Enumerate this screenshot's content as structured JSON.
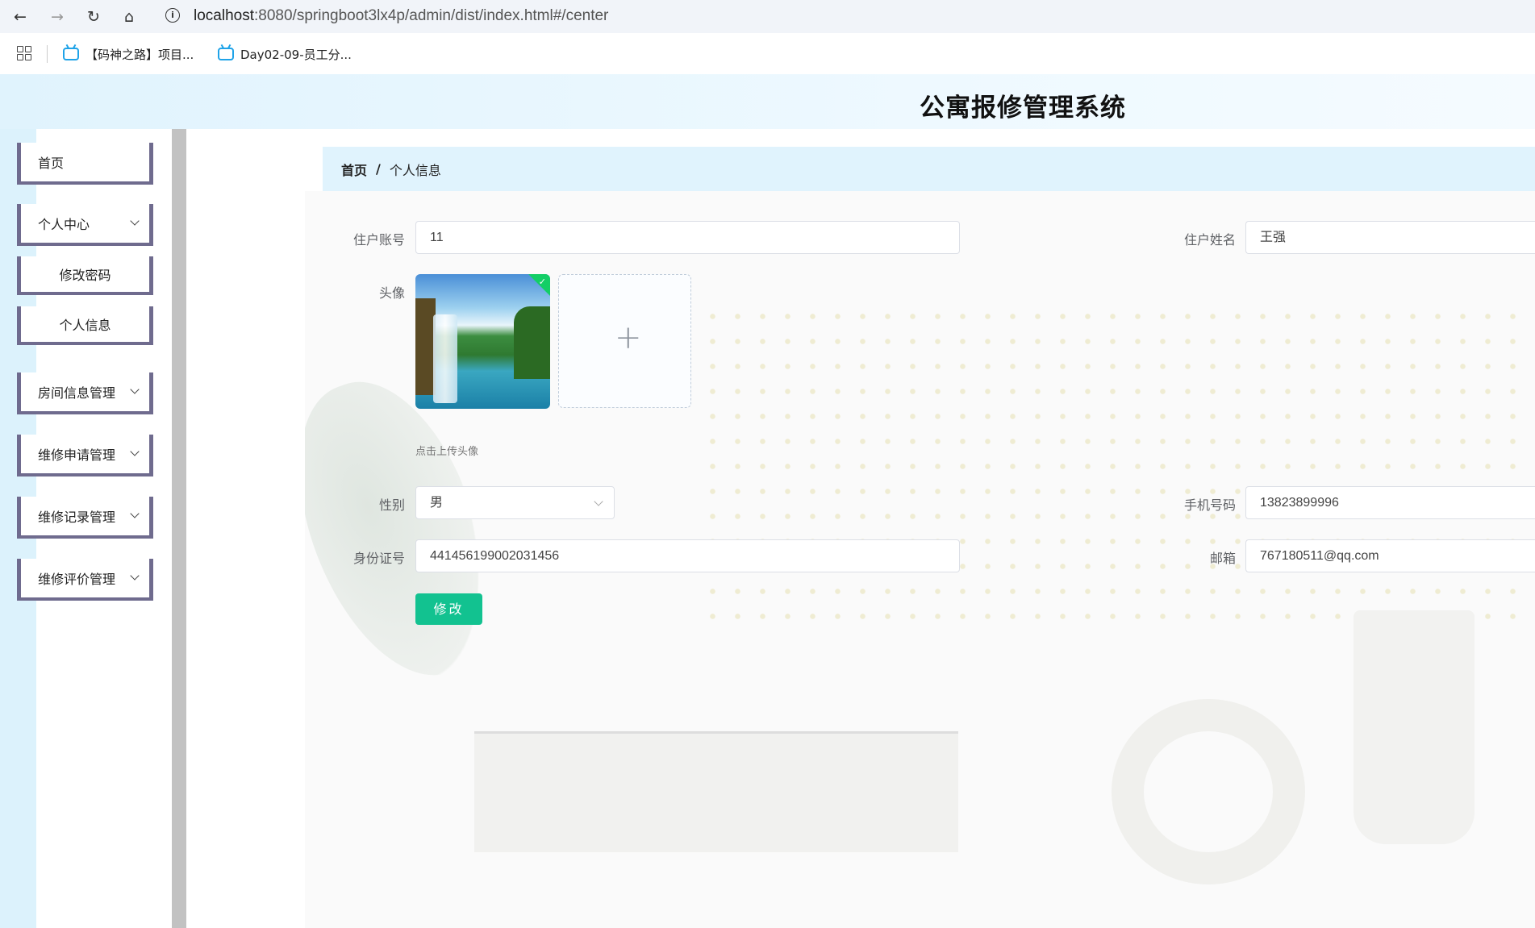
{
  "browser": {
    "url_host": "localhost",
    "url_path": ":8080/springboot3lx4p/admin/dist/index.html#/center",
    "bookmarks": [
      {
        "label": "【码神之路】项目..."
      },
      {
        "label": "Day02-09-员工分..."
      }
    ]
  },
  "header": {
    "title": "公寓报修管理系统"
  },
  "sidebar": {
    "items": [
      {
        "label": "首页"
      },
      {
        "label": "个人中心"
      },
      {
        "label": "修改密码"
      },
      {
        "label": "个人信息"
      },
      {
        "label": "房间信息管理"
      },
      {
        "label": "维修申请管理"
      },
      {
        "label": "维修记录管理"
      },
      {
        "label": "维修评价管理"
      }
    ]
  },
  "breadcrumb": {
    "home": "首页",
    "separator": "/",
    "current": "个人信息"
  },
  "form": {
    "account_label": "住户账号",
    "account_value": "11",
    "name_label": "住户姓名",
    "name_value": "王强",
    "avatar_label": "头像",
    "upload_tip": "点击上传头像",
    "gender_label": "性别",
    "gender_value": "男",
    "phone_label": "手机号码",
    "phone_value": "13823899996",
    "idcard_label": "身份证号",
    "idcard_value": "441456199002031456",
    "email_label": "邮箱",
    "email_value": "767180511@qq.com",
    "submit_label": "修改"
  },
  "colors": {
    "accent": "#12c290",
    "sidebar_border": "#6f6b8e",
    "topbar": "#e0f3fd"
  }
}
